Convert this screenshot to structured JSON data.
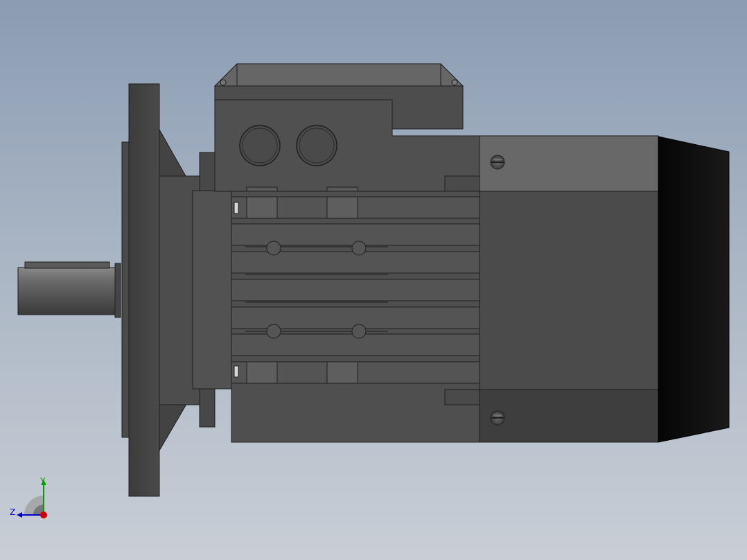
{
  "scene": {
    "background_top": "#8b9cb3",
    "background_bottom": "#c9ced6",
    "model_color": "#4f4f4f",
    "fan_cover_color": "#0a0a0a"
  },
  "triad": {
    "y_label": "Y",
    "z_label": "Z",
    "x_color": "#cc0000",
    "y_color": "#00a000",
    "z_color": "#0000cc"
  }
}
